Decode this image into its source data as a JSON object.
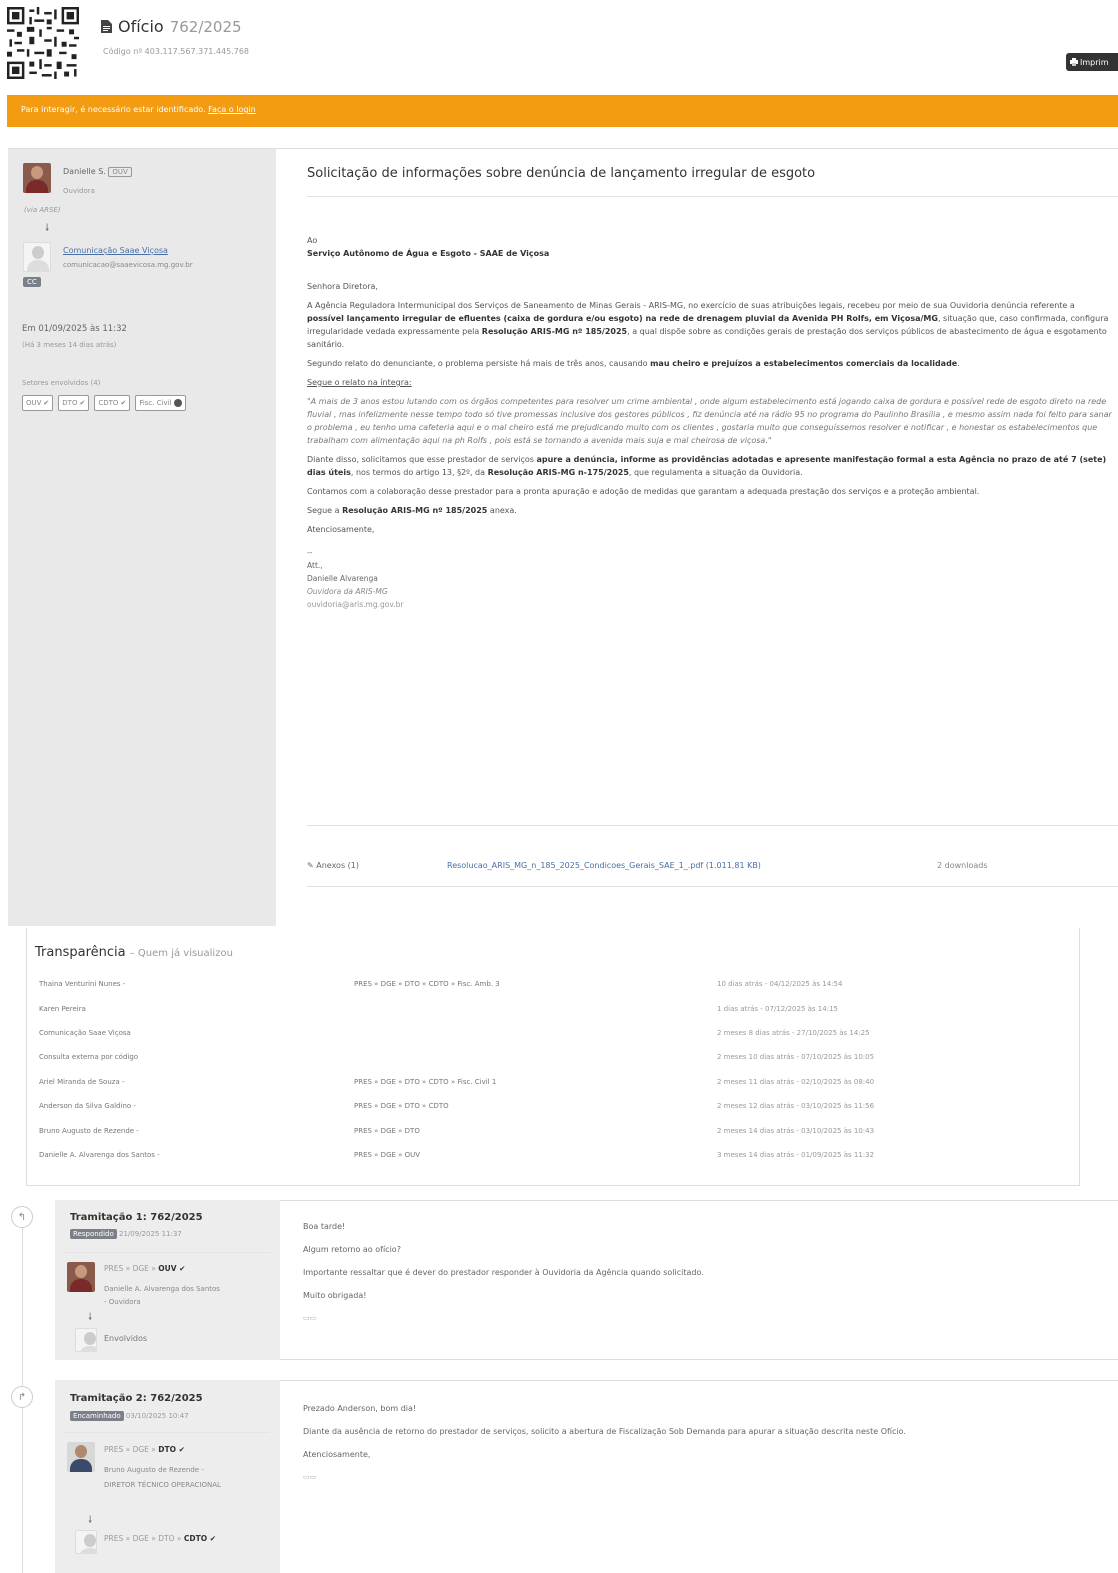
{
  "header": {
    "doc_type": "Ofício",
    "doc_number": "762/2025",
    "code_label": "Código nº 403.117.567.371.445.768",
    "print_label": "Imprim"
  },
  "login_banner": {
    "text": "Para interagir, é necessário estar identificado.",
    "link": "Faça o login"
  },
  "sender": {
    "name": "Danielle S.",
    "tag": "OUV",
    "role": "Ouvidora",
    "sub": "(via ARSE)"
  },
  "recipient": {
    "name": "Comunicação Saae Viçosa",
    "email": "comunicacao@saaevicosa.mg.gov.br",
    "badge": "CC"
  },
  "sent": {
    "date": "Em 01/09/2025 às 11:32",
    "ago": "(Há 3 meses 14 dias atrás)"
  },
  "sectors": {
    "label": "Setores envolvidos (4)",
    "tags": [
      "OUV",
      "DTO",
      "CDTO",
      "Fisc. Civil"
    ]
  },
  "letter": {
    "subject": "Solicitação de informações sobre denúncia de lançamento irregular de esgoto",
    "to_label": "Ao",
    "to_entity": "Serviço Autônomo de Água e Esgoto - SAAE de Viçosa",
    "salutation": "Senhora Diretora,",
    "p1_a": "A Agência Reguladora Intermunicipal dos Serviços de Saneamento de Minas Gerais - ARIS-MG, no exercício de suas atribuições legais, recebeu por meio de sua Ouvidoria denúncia referente a ",
    "p1_b": "possível lançamento irregular de efluentes (caixa de gordura e/ou esgoto) na rede de drenagem pluvial da Avenida PH Rolfs, em Viçosa/MG",
    "p1_c": ", situação que, caso confirmada, configura irregularidade vedada expressamente pela ",
    "p1_d": "Resolução ARIS-MG nº 185/2025",
    "p1_e": ", a qual dispõe sobre as condições gerais de prestação dos serviços públicos de abastecimento de água e esgotamento sanitário.",
    "p2_a": "Segundo relato do denunciante, o problema persiste há mais de três anos, causando ",
    "p2_b": "mau cheiro e prejuízos a estabelecimentos comerciais da localidade",
    "p2_c": ".",
    "p3": "Segue o relato na íntegra:",
    "quote": "\"A mais de 3 anos estou lutando com os órgãos competentes para resolver um crime ambiental , onde algum estabelecimento está jogando caixa de gordura e possível rede de esgoto direto na rede fluvial , mas infelizmente nesse tempo todo só tive promessas inclusive dos gestores públicos , fiz denúncia até na rádio 95 no programa do Paulinho Brasília , e mesmo assim nada foi feito para sanar o problema , eu tenho uma cafeteria aqui e o mal cheiro está me prejudicando muito com os clientes , gostaria muito que conseguíssemos resolver e notificar , e honestar os estabelecimentos que trabalham com alimentação aqui na ph Rolfs , pois está se tornando a avenida mais suja e mal cheirosa de viçosa.\"",
    "p4_a": "Diante disso, solicitamos que esse prestador de serviços ",
    "p4_b": "apure a denúncia, informe as providências adotadas e apresente manifestação formal a esta Agência no prazo de até 7 (sete) dias úteis",
    "p4_c": ", nos termos do artigo 13, §2º, da ",
    "p4_d": "Resolução ARIS-MG n-175/2025",
    "p4_e": ", que regulamenta a situação da Ouvidoria.",
    "p5": "Contamos com a colaboração desse prestador para a pronta apuração e adoção de medidas que garantam a adequada prestação dos serviços e a proteção ambiental.",
    "p6_a": "Segue a ",
    "p6_b": "Resolução ARIS-MG nº 185/2025",
    "p6_c": " anexa.",
    "closing": "Atenciosamente,",
    "sig_dash": "--",
    "sig_att": "Att.,",
    "sig_name": "Danielle Alvarenga",
    "sig_role": "Ouvidora da ARIS-MG",
    "sig_email": "ouvidoria@aris.mg.gov.br"
  },
  "attachments": {
    "label": "✎ Anexos (1)",
    "file": "Resolucao_ARIS_MG_n_185_2025_Condicoes_Gerais_SAE_1_.pdf (1.011,81 KB)",
    "downloads": "2 downloads"
  },
  "transparency": {
    "title": "Transparência",
    "subtitle": "– Quem já visualizou",
    "rows": [
      {
        "name": "Thaina Venturini Nunes -",
        "path": "PRES » DGE » DTO » CDTO » Fisc. Amb. 3",
        "time": "10 dias atrás - 04/12/2025 às 14:54"
      },
      {
        "name": "Karen Pereira",
        "path": "",
        "time": "1 dias atrás - 07/12/2025 às 14:15"
      },
      {
        "name": "Comunicação Saae Viçosa",
        "path": "",
        "time": "2 meses 8 dias atrás - 27/10/2025 às 14:25"
      },
      {
        "name": "Consulta externa por código",
        "path": "",
        "time": "2 meses 10 dias atrás - 07/10/2025 às 10:05"
      },
      {
        "name": "Ariel Miranda de Souza -",
        "path": "PRES » DGE » DTO » CDTO » Fisc. Civil 1",
        "time": "2 meses 11 dias atrás - 02/10/2025 às 08:40"
      },
      {
        "name": "Anderson da Silva Galdino -",
        "path": "PRES » DGE » DTO » CDTO",
        "time": "2 meses 12 dias atrás - 03/10/2025 às 11:56"
      },
      {
        "name": "Bruno Augusto de Rezende -",
        "path": "PRES » DGE » DTO",
        "time": "2 meses 14 dias atrás - 03/10/2025 às 10:43"
      },
      {
        "name": "Danielle A. Alvarenga dos Santos -",
        "path": "PRES » DGE » OUV",
        "time": "3 meses 14 dias atrás - 01/09/2025 às 11:32"
      }
    ]
  },
  "tramitacoes": [
    {
      "title": "Tramitação 1: 762/2025",
      "status": "Respondido",
      "date": "21/09/2025 11:37",
      "path_prefix": "PRES » DGE »",
      "path_end": "OUV ✔",
      "person": "Danielle A. Alvarenga dos Santos - Ouvidora",
      "target": "Envolvidos",
      "msg": [
        "Boa tarde!",
        "Algum retorno ao ofício?",
        "Importante ressaltar que é dever do prestador responder à Ouvidoria da Agência quando solicitado.",
        "Muito obrigada!"
      ]
    },
    {
      "title": "Tramitação 2: 762/2025",
      "status": "Encaminhado",
      "date": "03/10/2025 10:47",
      "path_prefix": "PRES » DGE »",
      "path_end": "DTO ✔",
      "person": "Bruno Augusto de Rezende - DIRETOR TÉCNICO OPERACIONAL",
      "target_prefix": "PRES » DGE » DTO »",
      "target_end": "CDTO ✔",
      "msg": [
        "Prezado Anderson, bom dia!",
        "Diante da ausência de retorno do prestador de serviços, solicito a abertura de Fiscalização Sob Demanda para apurar a situação descrita neste Ofício.",
        "Atenciosamente,"
      ]
    }
  ]
}
